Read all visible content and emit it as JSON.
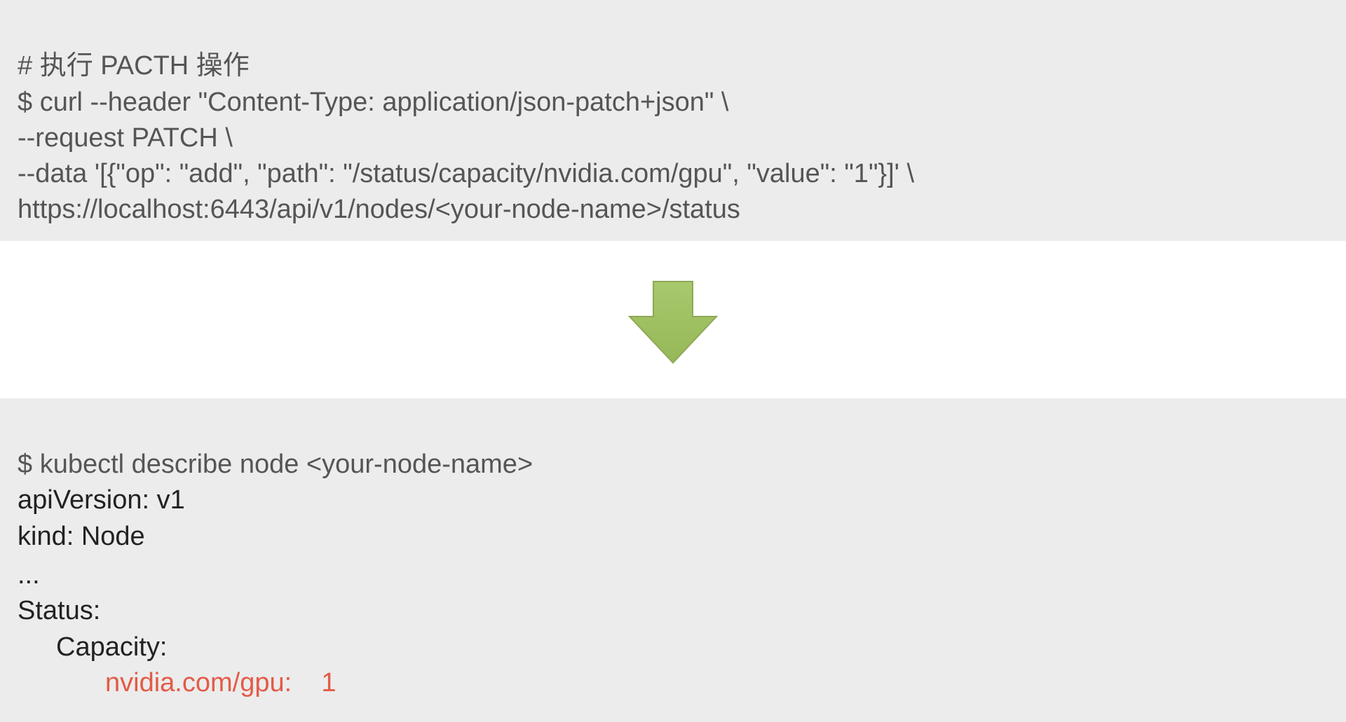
{
  "topBlock": {
    "l1": "# 执行 PACTH 操作",
    "l2": "$ curl --header \"Content-Type: application/json-patch+json\" \\",
    "l3": "--request PATCH \\",
    "l4": "--data '[{\"op\": \"add\", \"path\": \"/status/capacity/nvidia.com/gpu\", \"value\": \"1\"}]' \\",
    "l5": "https://localhost:6443/api/v1/nodes/<your-node-name>/status"
  },
  "bottomBlock": {
    "l1": "$ kubectl describe node <your-node-name>",
    "l2": "apiVersion: v1",
    "l3": "kind: Node",
    "l4": "...",
    "l5": "Status:",
    "l6": "Capacity:",
    "l7a": "nvidia.com/gpu:",
    "l7b": "1"
  },
  "colors": {
    "blockBg": "#ececec",
    "textGrey": "#555555",
    "textBlack": "#222222",
    "textRed": "#e35b47",
    "arrowFill": "#a0c062",
    "arrowStroke": "#8ea856"
  }
}
